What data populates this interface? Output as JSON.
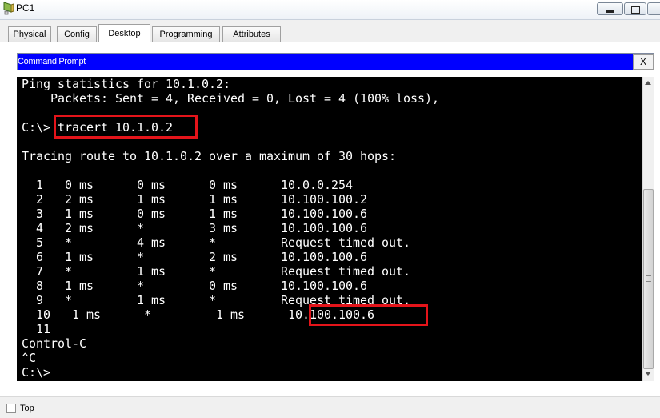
{
  "window": {
    "title": "PC1",
    "icon": "pc-icon",
    "controls": [
      "minimize-icon",
      "maximize-icon",
      "close-icon"
    ]
  },
  "tabs": [
    {
      "label": "Physical",
      "active": false
    },
    {
      "label": "Config",
      "active": false
    },
    {
      "label": "Desktop",
      "active": true
    },
    {
      "label": "Programming",
      "active": false
    },
    {
      "label": "Attributes",
      "active": false
    }
  ],
  "command_prompt": {
    "title": "Command Prompt",
    "close_label": "X",
    "header_color": "#0000ff",
    "highlight_color": "#e4141a"
  },
  "terminal": {
    "lines": [
      "Ping statistics for 10.1.0.2:",
      "    Packets: Sent = 4, Received = 0, Lost = 4 (100% loss),",
      "",
      "C:\\> tracert 10.1.0.2",
      "",
      "Tracing route to 10.1.0.2 over a maximum of 30 hops:",
      "",
      "  1   0 ms      0 ms      0 ms      10.0.0.254",
      "  2   2 ms      1 ms      1 ms      10.100.100.2",
      "  3   1 ms      0 ms      1 ms      10.100.100.6",
      "  4   2 ms      *         3 ms      10.100.100.6",
      "  5   *         4 ms      *         Request timed out.",
      "  6   1 ms      *         2 ms      10.100.100.6",
      "  7   *         1 ms      *         Request timed out.",
      "  8   1 ms      *         0 ms      10.100.100.6",
      "  9   *         1 ms      *         Request timed out.",
      "  10   1 ms      *         1 ms      10.100.100.6",
      "  11",
      "Control-C",
      "^C",
      "C:\\>"
    ]
  },
  "footer": {
    "top_checkbox_label": "Top",
    "top_checked": false
  }
}
